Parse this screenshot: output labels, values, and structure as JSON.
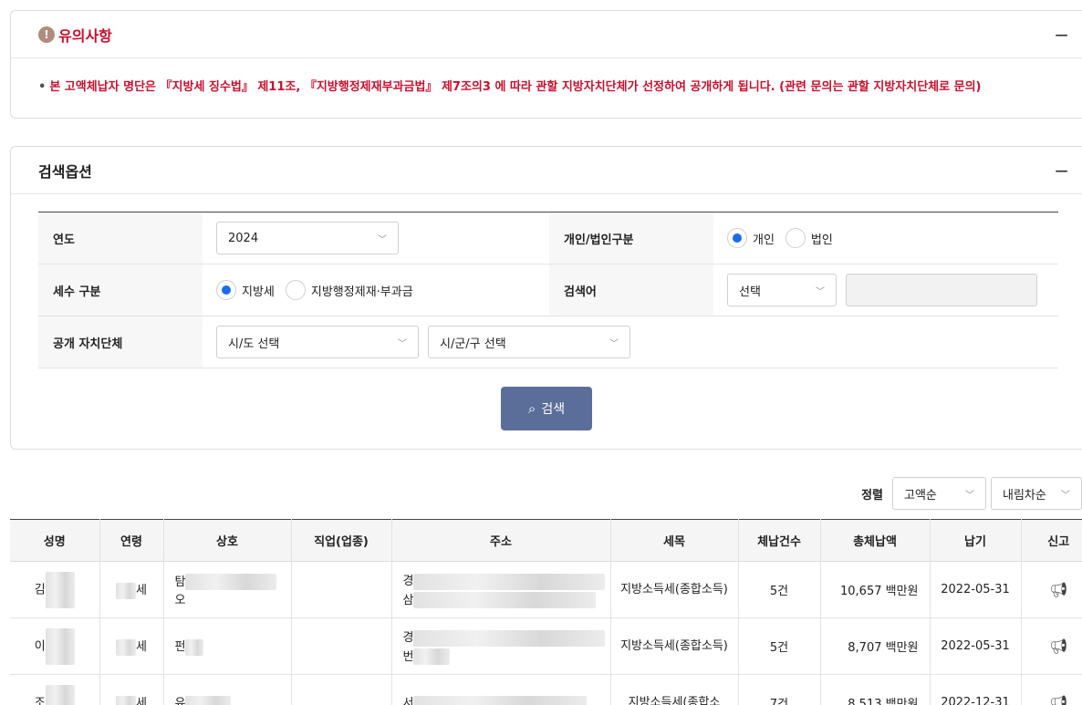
{
  "notice": {
    "title": "유의사항",
    "icon": "alert-icon",
    "collapse": "−",
    "text": "본 고액체납자 명단은 『지방세 징수법』 제11조, 『지방행정제재부과금법』 제7조의3 에 따라 관할 지방자치단체가 선정하여 공개하게 됩니다. (관련 문의는 관할 지방자치단체로 문의)"
  },
  "search": {
    "title": "검색옵션",
    "collapse": "−",
    "year_label": "연도",
    "year_value": "2024",
    "person_type_label": "개인/법인구분",
    "person_options": [
      "개인",
      "법인"
    ],
    "person_selected": "개인",
    "tax_type_label": "세수 구분",
    "tax_options": [
      "지방세",
      "지방행정제재·부과금"
    ],
    "tax_selected": "지방세",
    "keyword_label": "검색어",
    "keyword_select": "선택",
    "keyword_value": "",
    "region_label": "공개 자치단체",
    "sido_select": "시/도 선택",
    "sigungu_select": "시/군/구 선택",
    "search_button": "검색"
  },
  "sort": {
    "label": "정렬",
    "field": "고액순",
    "order": "내림차순"
  },
  "table": {
    "headers": [
      "성명",
      "연령",
      "상호",
      "직업(업종)",
      "주소",
      "세목",
      "체납건수",
      "총체납액",
      "납기",
      "신고"
    ],
    "rows": [
      {
        "name": "김",
        "age": "세",
        "company": "탐",
        "company2": "오",
        "job": "",
        "addr1": "경",
        "addr2": "삼",
        "item": "지방소득세(종합소득)",
        "count": "5건",
        "amount": "10,657 백만원",
        "due": "2022-05-31"
      },
      {
        "name": "이",
        "age": "세",
        "company": "펀",
        "company2": "",
        "job": "",
        "addr1": "경",
        "addr2": "번",
        "item": "지방소득세(종합소득)",
        "count": "5건",
        "amount": "8,707 백만원",
        "due": "2022-05-31"
      },
      {
        "name": "조",
        "age": "세",
        "company": "유",
        "company2": "",
        "job": "",
        "addr1": "서",
        "addr2": "",
        "item": "지방소득세(종합소",
        "count": "7건",
        "amount": "8,513 백만원",
        "due": "2022-12-31"
      }
    ]
  }
}
